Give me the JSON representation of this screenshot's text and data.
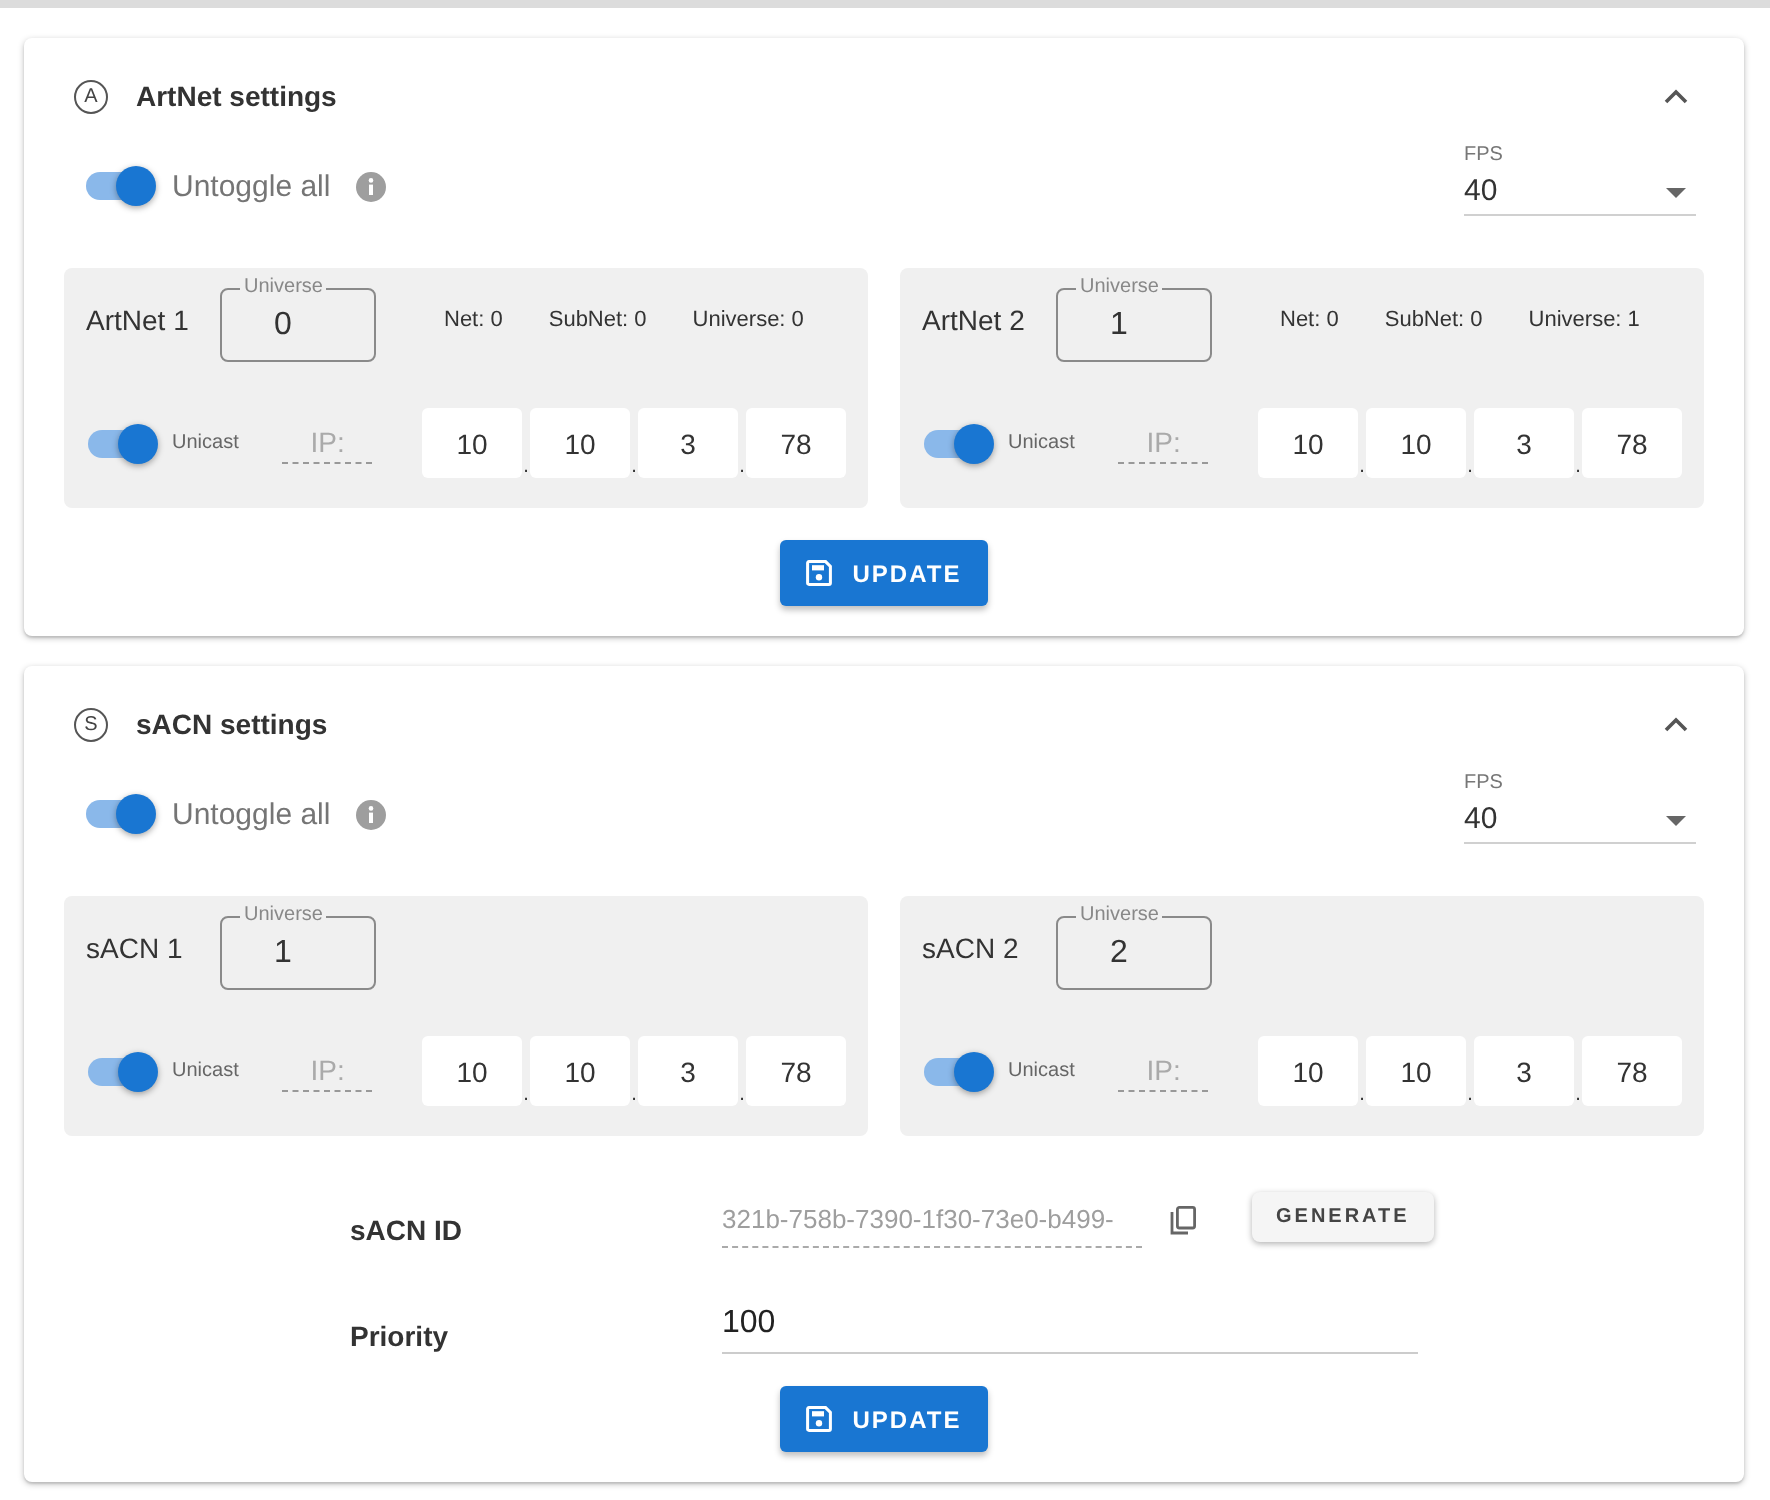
{
  "sections": [
    {
      "icon_letter": "A",
      "title": "ArtNet settings",
      "expanded": true,
      "untoggle_all": {
        "label": "Untoggle all",
        "on": true
      },
      "fps": {
        "label": "FPS",
        "value": "40"
      },
      "outputs": [
        {
          "name": "ArtNet 1",
          "universe_label": "Universe",
          "universe": "0",
          "details": [
            "Net: 0",
            "SubNet: 0",
            "Universe: 0"
          ],
          "unicast": {
            "label": "Unicast",
            "on": true
          },
          "ip_label": "IP:",
          "ip": [
            "10",
            "10",
            "3",
            "78"
          ],
          "ip_separators": [
            ".",
            ".",
            "."
          ]
        },
        {
          "name": "ArtNet 2",
          "universe_label": "Universe",
          "universe": "1",
          "details": [
            "Net: 0",
            "SubNet: 0",
            "Universe: 1"
          ],
          "unicast": {
            "label": "Unicast",
            "on": true
          },
          "ip_label": "IP:",
          "ip": [
            "10",
            "10",
            "3",
            "78"
          ],
          "ip_separators": [
            ".",
            ".",
            "."
          ]
        }
      ],
      "update_button": "UPDATE"
    },
    {
      "icon_letter": "S",
      "title": "sACN settings",
      "expanded": true,
      "untoggle_all": {
        "label": "Untoggle all",
        "on": true
      },
      "fps": {
        "label": "FPS",
        "value": "40"
      },
      "outputs": [
        {
          "name": "sACN 1",
          "universe_label": "Universe",
          "universe": "1",
          "unicast": {
            "label": "Unicast",
            "on": true
          },
          "ip_label": "IP:",
          "ip": [
            "10",
            "10",
            "3",
            "78"
          ],
          "ip_separators": [
            ".",
            ".",
            "."
          ]
        },
        {
          "name": "sACN 2",
          "universe_label": "Universe",
          "universe": "2",
          "unicast": {
            "label": "Unicast",
            "on": true
          },
          "ip_label": "IP:",
          "ip": [
            "10",
            "10",
            "3",
            "78"
          ],
          "ip_separators": [
            ".",
            ".",
            "."
          ]
        }
      ],
      "fields": [
        {
          "kind": "id",
          "label": "sACN ID",
          "value": "321b-758b-7390-1f30-73e0-b499-",
          "disabled": true,
          "button": "GENERATE"
        },
        {
          "kind": "number",
          "label": "Priority",
          "value": "100"
        }
      ],
      "update_button": "UPDATE"
    }
  ]
}
